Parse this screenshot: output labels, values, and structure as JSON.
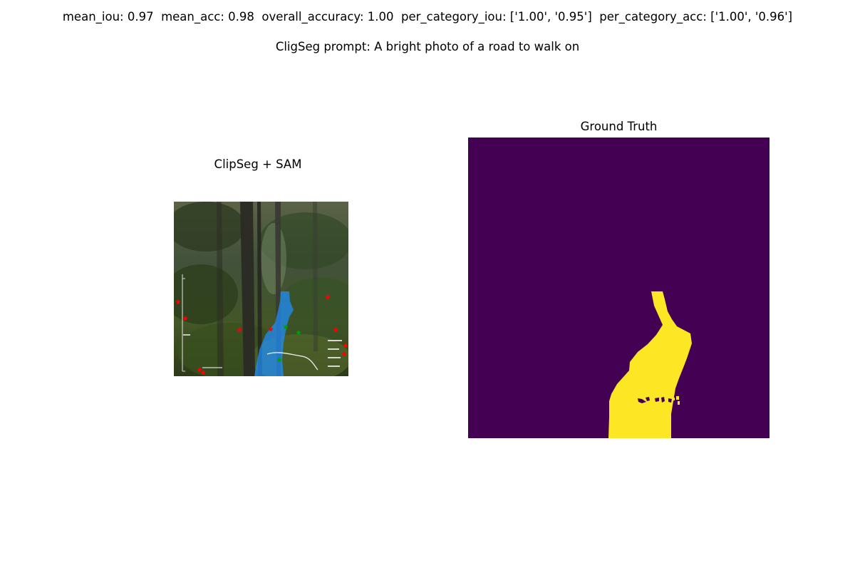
{
  "figure": {
    "metrics_text": "mean_iou: 0.97  mean_acc: 0.98  overall_accuracy: 1.00  per_category_iou: ['1.00', '0.95']  per_category_acc: ['1.00', '0.96']",
    "prompt_text": "CligSeg prompt: A bright photo of a road to walk on",
    "left_panel": {
      "title": "ClipSeg + SAM"
    },
    "right_panel": {
      "title": "Ground Truth"
    }
  },
  "colors": {
    "ground_truth_background": "#440154",
    "ground_truth_mask": "#fde725",
    "mask_overlay": "#1e90ff",
    "positive_points": "#00a000",
    "negative_points": "#ff0000"
  }
}
